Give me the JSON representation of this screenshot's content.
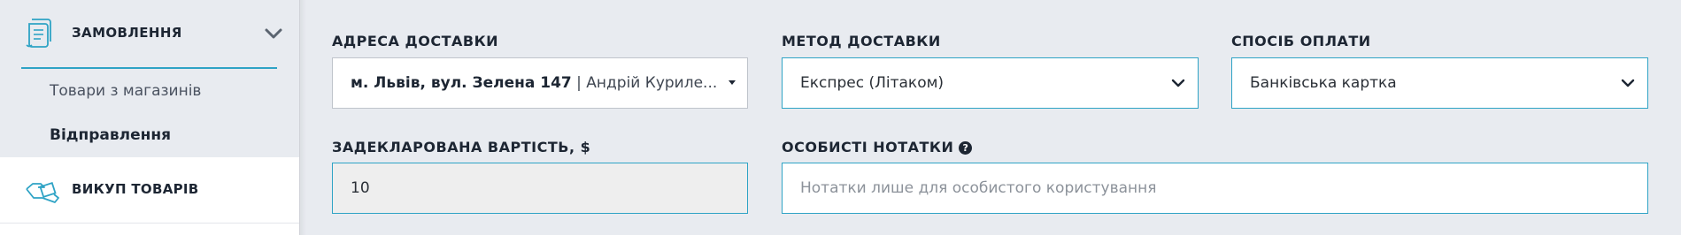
{
  "sidebar": {
    "orders_label": "ЗАМОВЛЕННЯ",
    "orders_icon": "document-scroll-icon",
    "expand_icon": "chevron-down-icon",
    "sub_items": [
      {
        "label": "Товари з магазинів",
        "active": false
      },
      {
        "label": "Відправлення",
        "active": true
      }
    ],
    "buyout_label": "ВИКУП ТОВАРІВ",
    "buyout_icon": "hand-box-icon"
  },
  "form": {
    "address": {
      "label": "АДРЕСА ДОСТАВКИ",
      "value_bold": "м. Львів, вул. Зелена 147",
      "value_rest": " | Андрій Куриле..."
    },
    "delivery_method": {
      "label": "МЕТОД ДОСТАВКИ",
      "value": "Експрес (Літаком)"
    },
    "payment": {
      "label": "СПОСІБ ОПЛАТИ",
      "value": "Банківська картка"
    },
    "declared_value": {
      "label": "ЗАДЕКЛАРОВАНА ВАРТІСТЬ, $",
      "value": "10"
    },
    "notes": {
      "label": "ОСОБИСТІ НОТАТКИ",
      "help_icon": "?",
      "placeholder": "Нотатки лише для особистого користування"
    }
  },
  "colors": {
    "accent": "#2ea3c5",
    "text_dark": "#1d2633",
    "background": "#e8ebf0"
  }
}
